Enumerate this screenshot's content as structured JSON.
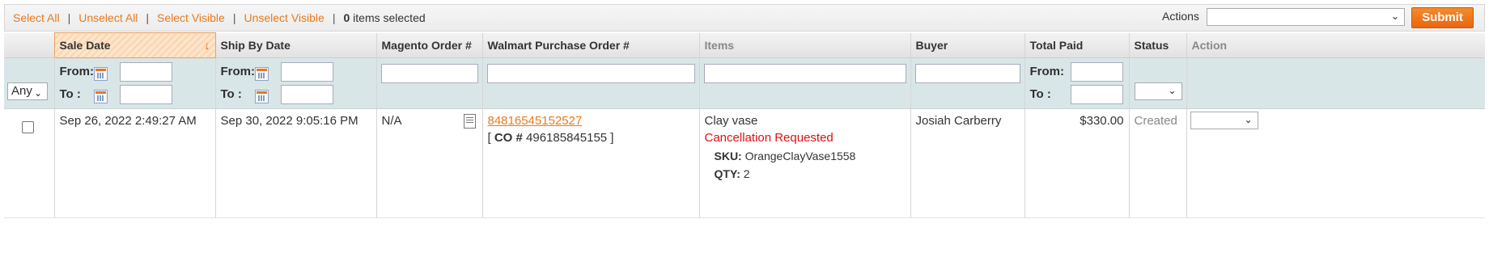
{
  "massaction": {
    "select_all": "Select All",
    "unselect_all": "Unselect All",
    "select_visible": "Select Visible",
    "unselect_visible": "Unselect Visible",
    "separator": "|",
    "selected_count": "0",
    "selected_suffix": "items selected",
    "actions_label": "Actions",
    "actions_value": "",
    "submit_label": "Submit"
  },
  "columns": {
    "sale_date": "Sale Date",
    "ship_by_date": "Ship By Date",
    "magento_order": "Magento Order #",
    "walmart_po": "Walmart Purchase Order #",
    "items": "Items",
    "buyer": "Buyer",
    "total_paid": "Total Paid",
    "status": "Status",
    "action": "Action"
  },
  "filters": {
    "any_select": "Any",
    "from_label": "From:",
    "to_label": "To :",
    "sale_from": "",
    "sale_to": "",
    "ship_from": "",
    "ship_to": "",
    "magento_order": "",
    "walmart_po": "",
    "items": "",
    "buyer": "",
    "total_from": "",
    "total_to": "",
    "status": ""
  },
  "rows": [
    {
      "sale_date": "Sep 26, 2022 2:49:27 AM",
      "ship_by_date": "Sep 30, 2022 9:05:16 PM",
      "magento_order": "N/A",
      "walmart_po": "84816545152527",
      "co_prefix": "[ ",
      "co_label": "CO #",
      "co_number": "496185845155",
      "co_suffix": " ]",
      "item_name": "Clay vase",
      "item_status": "Cancellation Requested",
      "sku_label": "SKU:",
      "sku_value": "OrangeClayVase1558",
      "qty_label": "QTY:",
      "qty_value": "2",
      "buyer": "Josiah Carberry",
      "total_paid": "$330.00",
      "status": "Created",
      "action": ""
    }
  ],
  "colors": {
    "accent": "#e87b1e",
    "submit": "#e9660f",
    "filter_bg": "#d9e6e7",
    "cancel_text": "#e01010"
  }
}
